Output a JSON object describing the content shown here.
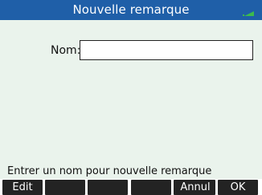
{
  "screen": {
    "title": "Nouvelle remarque",
    "battery_color": "#3dbb4c",
    "title_bar_color": "#1f5fa8",
    "background_color": "#eaf3ec"
  },
  "form": {
    "name_label": "Nom:",
    "name_value": ""
  },
  "help_text": "Entrer un nom pour nouvelle remarque",
  "menu": {
    "keys": [
      "Edit",
      "",
      "",
      "",
      "",
      "Annul",
      "OK"
    ]
  }
}
